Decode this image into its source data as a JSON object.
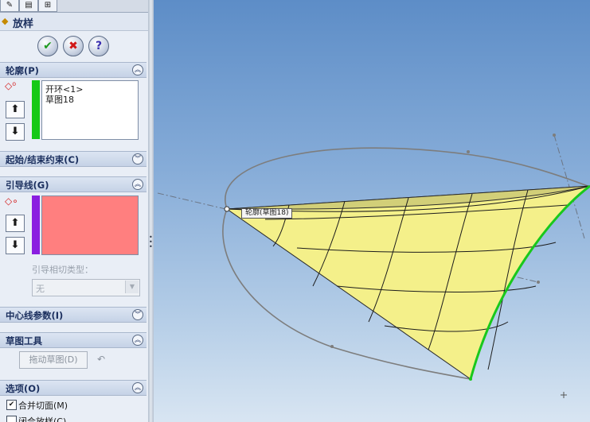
{
  "tabs": [
    {
      "icon": "feature-manager-icon",
      "glyph": "✎"
    },
    {
      "icon": "property-manager-icon",
      "glyph": "▤"
    },
    {
      "icon": "configuration-manager-icon",
      "glyph": "⊞"
    }
  ],
  "feature": {
    "title": "放样",
    "icon": "loft-icon"
  },
  "actions": {
    "ok": "✔",
    "cancel": "✖",
    "help": "?"
  },
  "sections": {
    "profiles": {
      "label": "轮廓(P)",
      "items": [
        "开环<1>",
        "草图18"
      ],
      "bar_color": "#16c916"
    },
    "start_end": {
      "label": "起始/结束约束(C)"
    },
    "guides": {
      "label": "引导线(G)",
      "bar_color": "#8a1ee0",
      "list_bg": "#ff7f7f",
      "tangency_label": "引导相切类型：",
      "tangency_value": "无"
    },
    "centerline": {
      "label": "中心线参数(I)"
    },
    "sketch_tools": {
      "label": "草图工具",
      "drag_button": "拖动草图(D)"
    },
    "options": {
      "label": "选项(O)",
      "merge_tangent": "合并切面(M)",
      "closed_loft": "闭合放样(C)"
    }
  },
  "viewport": {
    "callout": "轮廓(草图18)",
    "surface_color": "#f4f08a",
    "edge_color": "#19c81c"
  }
}
